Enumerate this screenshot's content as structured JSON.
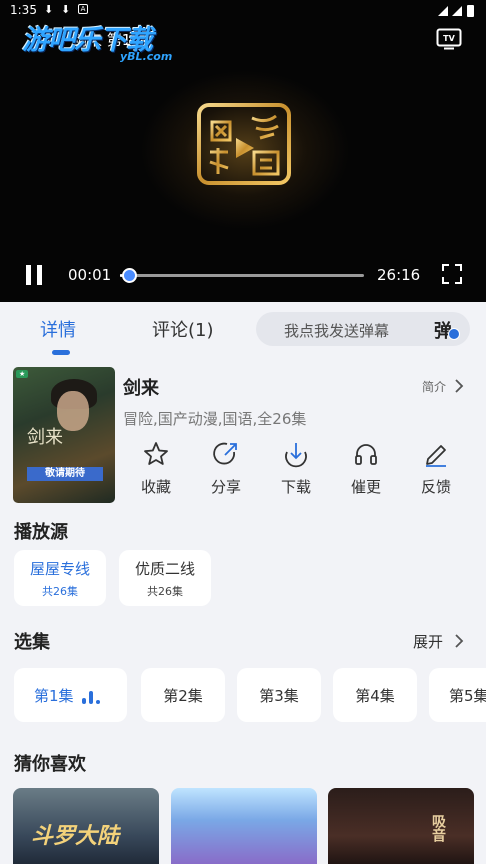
{
  "status_bar": {
    "time": "1:35"
  },
  "player": {
    "title": "剑来 第1集",
    "watermark_main": "游吧乐下载",
    "watermark_sub": "yBL.com",
    "current_time": "00:01",
    "total_time": "26:16",
    "progress": 0.01
  },
  "tabs": {
    "details": "详情",
    "comments": "评论(1)",
    "danmu_placeholder": "我点我发送弹幕",
    "danmu_button": "弹"
  },
  "show": {
    "title": "剑来",
    "intro_link": "简介",
    "meta": "冒险,国产动漫,国语,全26集",
    "poster_title": "剑来",
    "poster_banner": "敬请期待"
  },
  "actions": [
    {
      "label": "收藏",
      "icon": "star-icon"
    },
    {
      "label": "分享",
      "icon": "share-icon"
    },
    {
      "label": "下载",
      "icon": "download-icon"
    },
    {
      "label": "催更",
      "icon": "headphones-icon"
    },
    {
      "label": "反馈",
      "icon": "edit-icon"
    }
  ],
  "sources": {
    "title": "播放源",
    "items": [
      {
        "name": "屋屋专线",
        "count": "共26集",
        "active": true
      },
      {
        "name": "优质二线",
        "count": "共26集",
        "active": false
      }
    ]
  },
  "episodes": {
    "title": "选集",
    "expand": "展开",
    "items": [
      "第1集",
      "第2集",
      "第3集",
      "第4集",
      "第5集"
    ]
  },
  "recommend": {
    "title": "猜你喜欢",
    "items": [
      {
        "title": "斗罗大陆"
      },
      {
        "title": ""
      },
      {
        "title": "吸音"
      }
    ]
  },
  "colors": {
    "accent": "#2a6fdb",
    "page_bg": "#f2f3f7"
  }
}
